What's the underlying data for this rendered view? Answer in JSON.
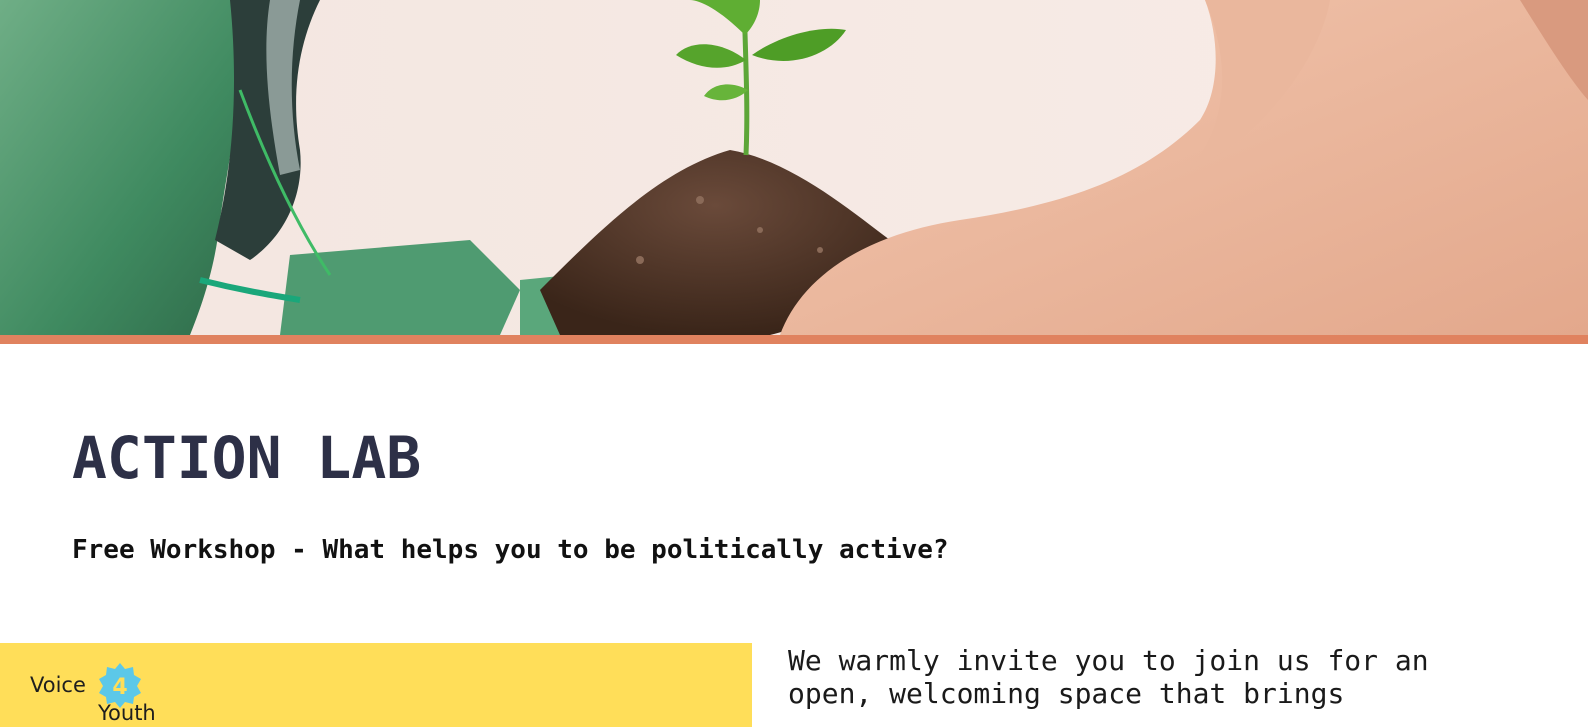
{
  "colors": {
    "accent_rule": "#e0825f",
    "title": "#2d3047",
    "banner": "#ffde59",
    "badge": "#5cc8e8"
  },
  "hero": {
    "image_description_icon": "plant-in-soil-held-by-robot-and-human-hands-icon"
  },
  "page_title": "ACTION LAB",
  "subtitle": "Free Workshop - What helps you to be politically active?",
  "logo": {
    "word_1": "Voice",
    "badge_number": "4",
    "word_2": "Youth"
  },
  "intro": {
    "line_1": "We warmly invite you to join us for an",
    "line_2": "open, welcoming space that brings"
  }
}
